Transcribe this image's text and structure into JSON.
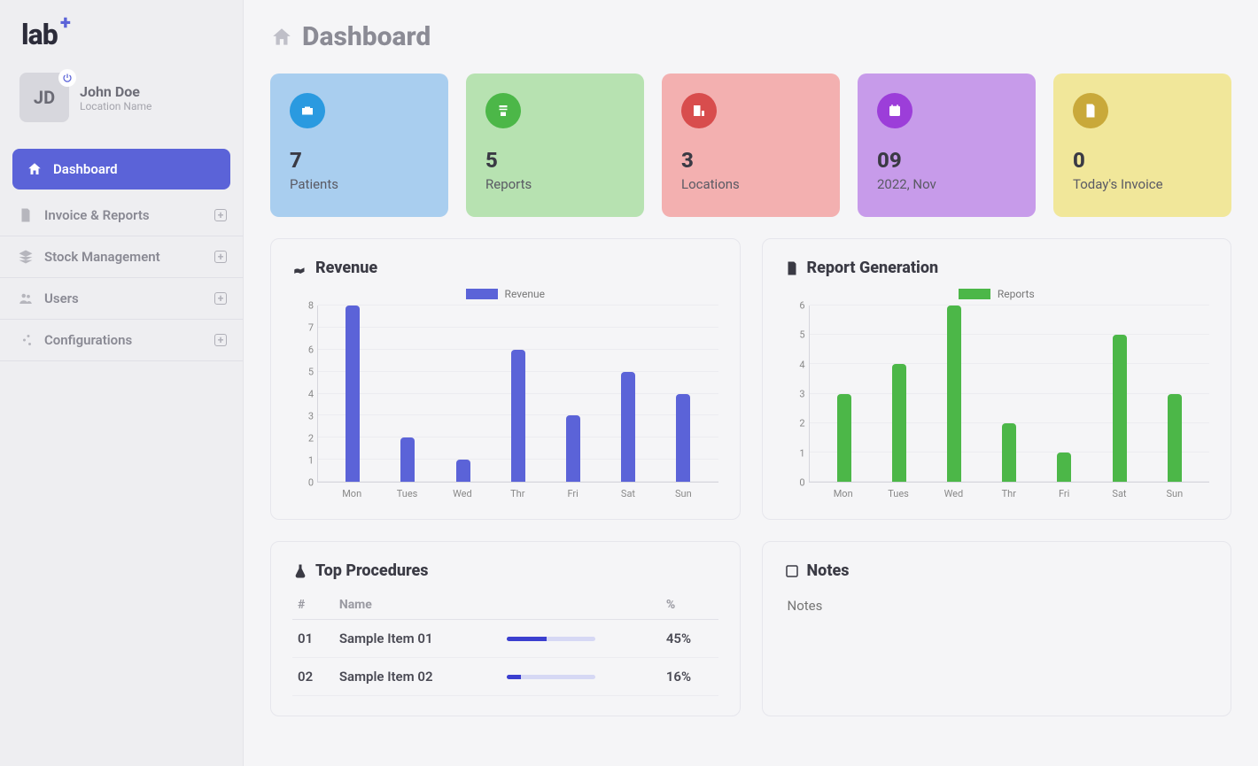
{
  "logo": {
    "text": "lab",
    "plus": "+"
  },
  "user": {
    "initials": "JD",
    "name": "John Doe",
    "location": "Location Name"
  },
  "page": {
    "title": "Dashboard"
  },
  "sidebar": {
    "items": [
      {
        "label": "Dashboard"
      },
      {
        "label": "Invoice & Reports"
      },
      {
        "label": "Stock Management"
      },
      {
        "label": "Users"
      },
      {
        "label": "Configurations"
      }
    ]
  },
  "kpis": [
    {
      "value": "7",
      "label": "Patients",
      "color": "blue"
    },
    {
      "value": "5",
      "label": "Reports",
      "color": "green"
    },
    {
      "value": "3",
      "label": "Locations",
      "color": "red"
    },
    {
      "value": "09",
      "label": "2022, Nov",
      "color": "purple"
    },
    {
      "value": "0",
      "label": "Today's Invoice",
      "color": "yellow"
    }
  ],
  "revenue": {
    "title": "Revenue",
    "legend": "Revenue",
    "color": "#5b63d8"
  },
  "reports": {
    "title": "Report Generation",
    "legend": "Reports",
    "color": "#4cb748"
  },
  "procedures": {
    "title": "Top Procedures",
    "headers": {
      "idx": "#",
      "name": "Name",
      "pct": "%"
    },
    "rows": [
      {
        "idx": "01",
        "name": "Sample Item 01",
        "pct": "45%",
        "pct_n": 45
      },
      {
        "idx": "02",
        "name": "Sample Item 02",
        "pct": "16%",
        "pct_n": 16
      }
    ]
  },
  "notes": {
    "title": "Notes",
    "placeholder": "Notes"
  },
  "chart_data": [
    {
      "type": "bar",
      "title": "Revenue",
      "categories": [
        "Mon",
        "Tues",
        "Wed",
        "Thr",
        "Fri",
        "Sat",
        "Sun"
      ],
      "series": [
        {
          "name": "Revenue",
          "values": [
            8,
            2,
            1,
            6,
            3,
            5,
            4
          ],
          "color": "#5b63d8"
        }
      ],
      "ylim": [
        0,
        8
      ],
      "yticks": [
        0,
        1,
        2,
        3,
        4,
        5,
        6,
        7,
        8
      ],
      "xlabel": "",
      "ylabel": ""
    },
    {
      "type": "bar",
      "title": "Report Generation",
      "categories": [
        "Mon",
        "Tues",
        "Wed",
        "Thr",
        "Fri",
        "Sat",
        "Sun"
      ],
      "series": [
        {
          "name": "Reports",
          "values": [
            3,
            4,
            6,
            2,
            1,
            5,
            3
          ],
          "color": "#4cb748"
        }
      ],
      "ylim": [
        0,
        6
      ],
      "yticks": [
        0,
        1,
        2,
        3,
        4,
        5,
        6
      ],
      "xlabel": "",
      "ylabel": ""
    }
  ]
}
